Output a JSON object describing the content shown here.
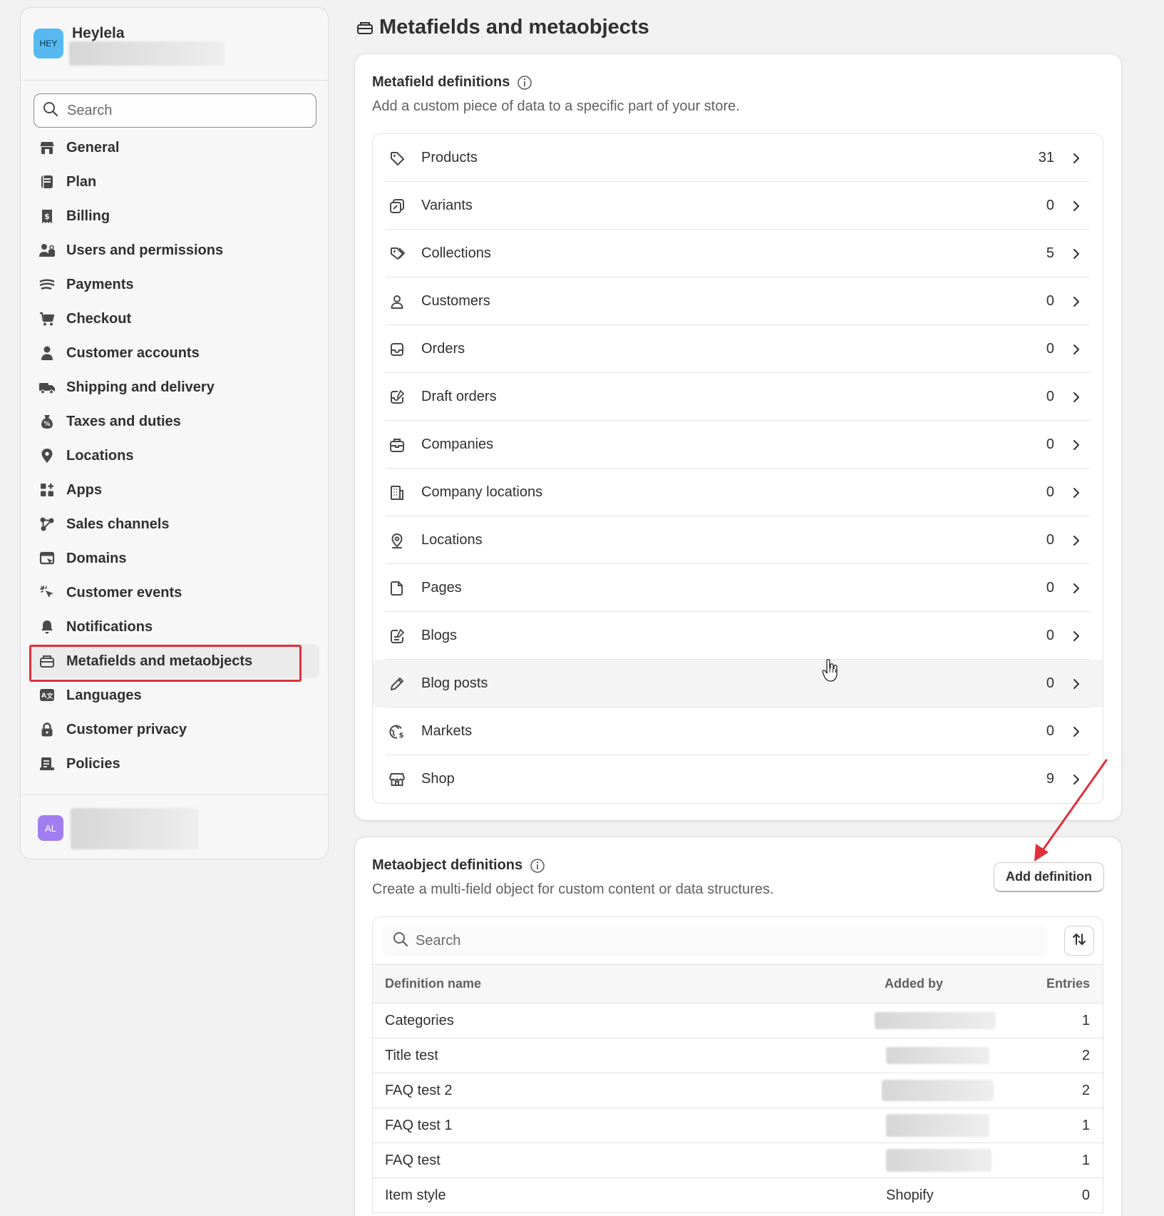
{
  "store": {
    "avatar_initials": "HEY",
    "name": "Heylela"
  },
  "sidebar": {
    "search_placeholder": "Search",
    "items": [
      {
        "label": "General",
        "icon": "store-icon"
      },
      {
        "label": "Plan",
        "icon": "plan-icon"
      },
      {
        "label": "Billing",
        "icon": "billing-icon"
      },
      {
        "label": "Users and permissions",
        "icon": "users-icon"
      },
      {
        "label": "Payments",
        "icon": "payments-icon"
      },
      {
        "label": "Checkout",
        "icon": "cart-icon"
      },
      {
        "label": "Customer accounts",
        "icon": "person-icon"
      },
      {
        "label": "Shipping and delivery",
        "icon": "truck-icon"
      },
      {
        "label": "Taxes and duties",
        "icon": "tax-icon"
      },
      {
        "label": "Locations",
        "icon": "location-pin-icon"
      },
      {
        "label": "Apps",
        "icon": "apps-icon"
      },
      {
        "label": "Sales channels",
        "icon": "sales-channels-icon"
      },
      {
        "label": "Domains",
        "icon": "domains-icon"
      },
      {
        "label": "Customer events",
        "icon": "cursor-click-icon"
      },
      {
        "label": "Notifications",
        "icon": "bell-icon"
      },
      {
        "label": "Metafields and metaobjects",
        "icon": "metafields-icon",
        "active": true
      },
      {
        "label": "Languages",
        "icon": "languages-icon"
      },
      {
        "label": "Customer privacy",
        "icon": "lock-icon"
      },
      {
        "label": "Policies",
        "icon": "policies-icon"
      }
    ]
  },
  "user": {
    "avatar_initials": "AL"
  },
  "page": {
    "title": "Metafields and metaobjects"
  },
  "metafields": {
    "title": "Metafield definitions",
    "description": "Add a custom piece of data to a specific part of your store.",
    "rows": [
      {
        "label": "Products",
        "count": "31",
        "icon": "tag-icon"
      },
      {
        "label": "Variants",
        "count": "0",
        "icon": "variants-icon"
      },
      {
        "label": "Collections",
        "count": "5",
        "icon": "collections-icon"
      },
      {
        "label": "Customers",
        "count": "0",
        "icon": "person-icon"
      },
      {
        "label": "Orders",
        "count": "0",
        "icon": "inbox-icon"
      },
      {
        "label": "Draft orders",
        "count": "0",
        "icon": "draft-order-icon"
      },
      {
        "label": "Companies",
        "count": "0",
        "icon": "briefcase-icon"
      },
      {
        "label": "Company locations",
        "count": "0",
        "icon": "building-icon"
      },
      {
        "label": "Locations",
        "count": "0",
        "icon": "location-pin-icon"
      },
      {
        "label": "Pages",
        "count": "0",
        "icon": "page-icon"
      },
      {
        "label": "Blogs",
        "count": "0",
        "icon": "blog-icon"
      },
      {
        "label": "Blog posts",
        "count": "0",
        "icon": "pencil-icon"
      },
      {
        "label": "Markets",
        "count": "0",
        "icon": "globe-dollar-icon"
      },
      {
        "label": "Shop",
        "count": "9",
        "icon": "store-icon"
      }
    ]
  },
  "metaobjects": {
    "title": "Metaobject definitions",
    "description": "Create a multi-field object for custom content or data structures.",
    "add_button": "Add definition",
    "search_placeholder": "Search",
    "columns": {
      "name": "Definition name",
      "added_by": "Added by",
      "entries": "Entries"
    },
    "rows": [
      {
        "name": "Categories",
        "added_by": "",
        "entries": "1"
      },
      {
        "name": "Title test",
        "added_by": "",
        "entries": "2"
      },
      {
        "name": "FAQ test 2",
        "added_by": "",
        "entries": "2"
      },
      {
        "name": "FAQ test 1",
        "added_by": "",
        "entries": "1"
      },
      {
        "name": "FAQ test",
        "added_by": "",
        "entries": "1"
      },
      {
        "name": "Item style",
        "added_by": "Shopify",
        "entries": "0"
      }
    ]
  },
  "colors": {
    "background": "#f1f1f1",
    "card": "#ffffff",
    "text": "#303030",
    "muted": "#616161",
    "highlight_annotation": "#e0303c",
    "store_avatar": "#56b9f2",
    "user_avatar": "#a17ef0"
  }
}
